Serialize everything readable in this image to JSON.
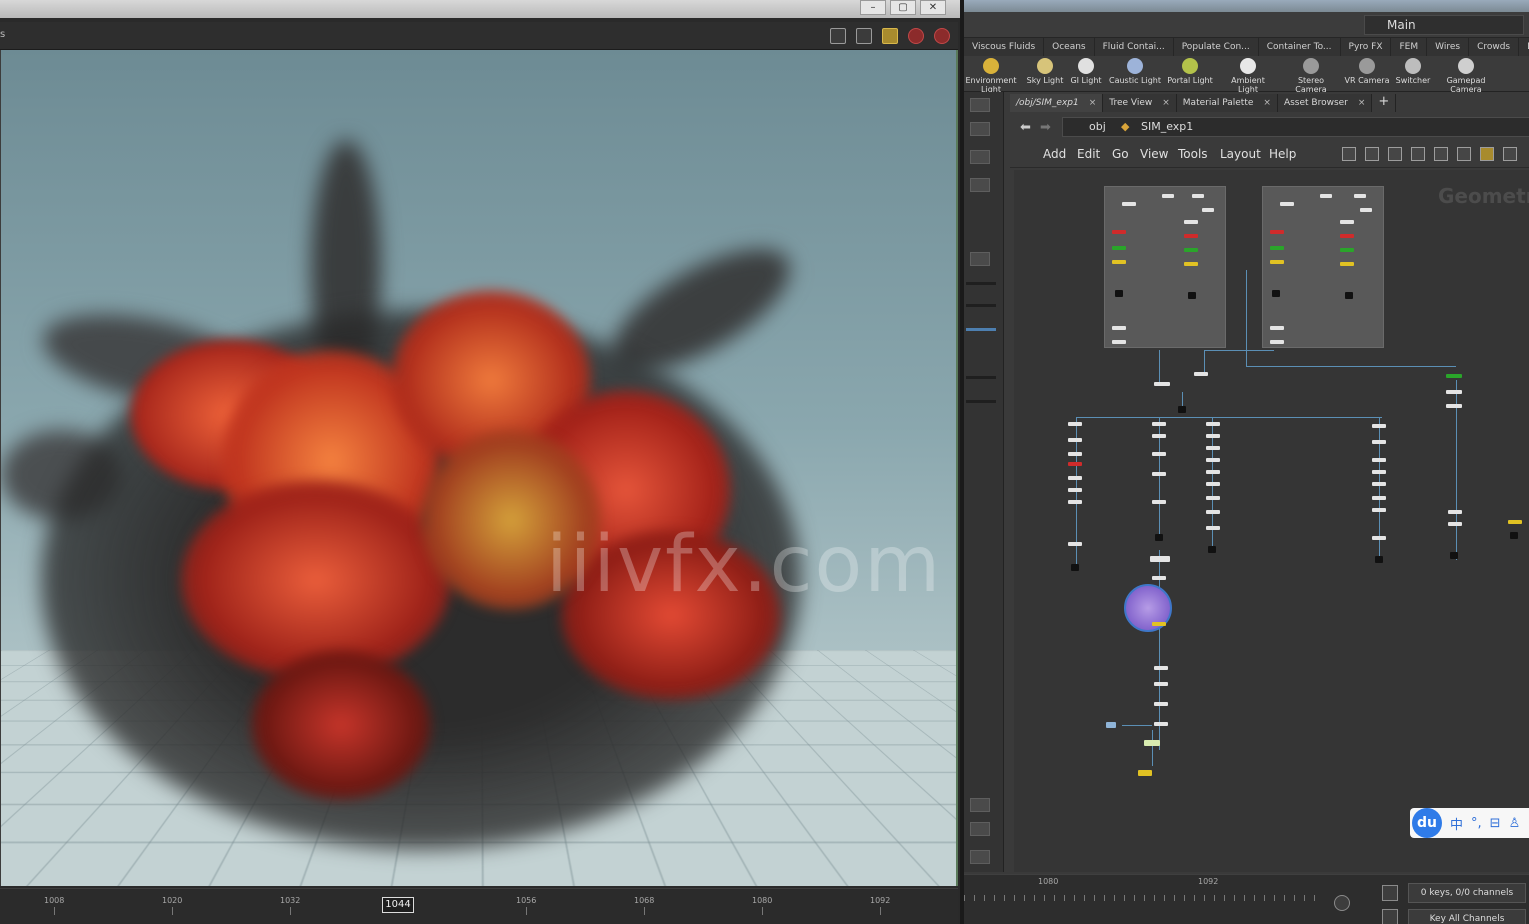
{
  "viewport": {
    "window_buttons": [
      "–",
      "▢",
      "✕"
    ],
    "toolbar_left": "s",
    "watermark": "iiivfx.com",
    "timeline": {
      "ticks": [
        "1008",
        "1020",
        "1032",
        "1044",
        "1056",
        "1068",
        "1080",
        "1092"
      ],
      "current_frame": "1044"
    }
  },
  "desktop": {
    "name": "Main"
  },
  "shelf": {
    "tabs": [
      "Viscous Fluids",
      "Oceans",
      "Fluid Contai...",
      "Populate Con...",
      "Container To...",
      "Pyro FX",
      "FEM",
      "Wires",
      "Crowds",
      "Drive Simul..."
    ],
    "tools": [
      {
        "label": "Environment Light",
        "icon": "environment-light-icon",
        "color": "#d9b23a"
      },
      {
        "label": "Sky Light",
        "icon": "sky-light-icon",
        "color": "#d7c47a"
      },
      {
        "label": "GI Light",
        "icon": "gi-light-icon",
        "color": "#e0e0e0"
      },
      {
        "label": "Caustic Light",
        "icon": "caustic-light-icon",
        "color": "#9db3d9"
      },
      {
        "label": "Portal Light",
        "icon": "portal-light-icon",
        "color": "#b3c24a"
      },
      {
        "label": "Ambient Light",
        "icon": "ambient-light-icon",
        "color": "#e8e8e8"
      },
      {
        "label": "Stereo Camera",
        "icon": "stereo-camera-icon",
        "color": "#9a9a9a"
      },
      {
        "label": "VR Camera",
        "icon": "vr-camera-icon",
        "color": "#9a9a9a"
      },
      {
        "label": "Switcher",
        "icon": "switcher-icon",
        "color": "#bdbdbd"
      },
      {
        "label": "Gamepad Camera",
        "icon": "gamepad-camera-icon",
        "color": "#cfcfcf"
      }
    ]
  },
  "network": {
    "tabs": [
      {
        "label": "/obj/SIM_exp1",
        "close": "×"
      },
      {
        "label": "Tree View",
        "close": "×"
      },
      {
        "label": "Material Palette",
        "close": "×"
      },
      {
        "label": "Asset Browser",
        "close": "×"
      }
    ],
    "add_tab": "+",
    "path": {
      "root": "obj",
      "node": "SIM_exp1"
    },
    "menu": [
      "Add",
      "Edit",
      "Go",
      "View",
      "Tools",
      "Layout",
      "Help"
    ],
    "context_label": "Geometr"
  },
  "ime": {
    "logo": "du",
    "items": [
      "中",
      "°,",
      "⊟",
      "♙",
      "⊞"
    ]
  },
  "channels": {
    "ticks": [
      "1080",
      "1092"
    ],
    "keys_label": "0 keys, 0/0 channels",
    "key_all_label": "Key All Channels"
  }
}
